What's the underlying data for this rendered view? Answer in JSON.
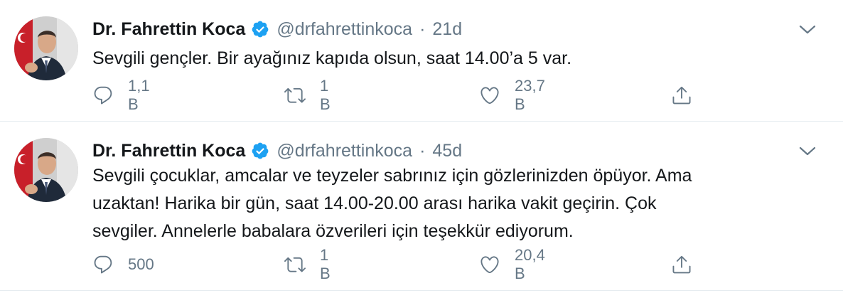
{
  "tweets": [
    {
      "name": "Dr. Fahrettin Koca",
      "handle": "@drfahrettinkoca",
      "separator": "·",
      "time": "21d",
      "text": "Sevgili gençler. Bir ayağınız kapıda olsun, saat 14.00’a 5 var.",
      "replies": "1,1 B",
      "retweets": "1 B",
      "likes": "23,7 B"
    },
    {
      "name": "Dr. Fahrettin Koca",
      "handle": "@drfahrettinkoca",
      "separator": "·",
      "time": "45d",
      "text": "Sevgili çocuklar, amcalar ve teyzeler sabrınız için gözlerinizden öpüyor. Ama\nuzaktan! Harika bir gün, saat 14.00-20.00 arası harika vakit geçirin. Çok\nsevgiler. Annelerle babalara özverileri için teşekkür ediyorum.",
      "replies": "500",
      "retweets": "1 B",
      "likes": "20,4 B"
    }
  ],
  "colors": {
    "text": "#14171a",
    "secondary": "#657786",
    "verified": "#1da1f2",
    "divider": "#e6ecf0"
  },
  "icons": [
    "verified-badge-icon",
    "chevron-down-icon",
    "reply-icon",
    "retweet-icon",
    "like-icon",
    "share-icon"
  ]
}
